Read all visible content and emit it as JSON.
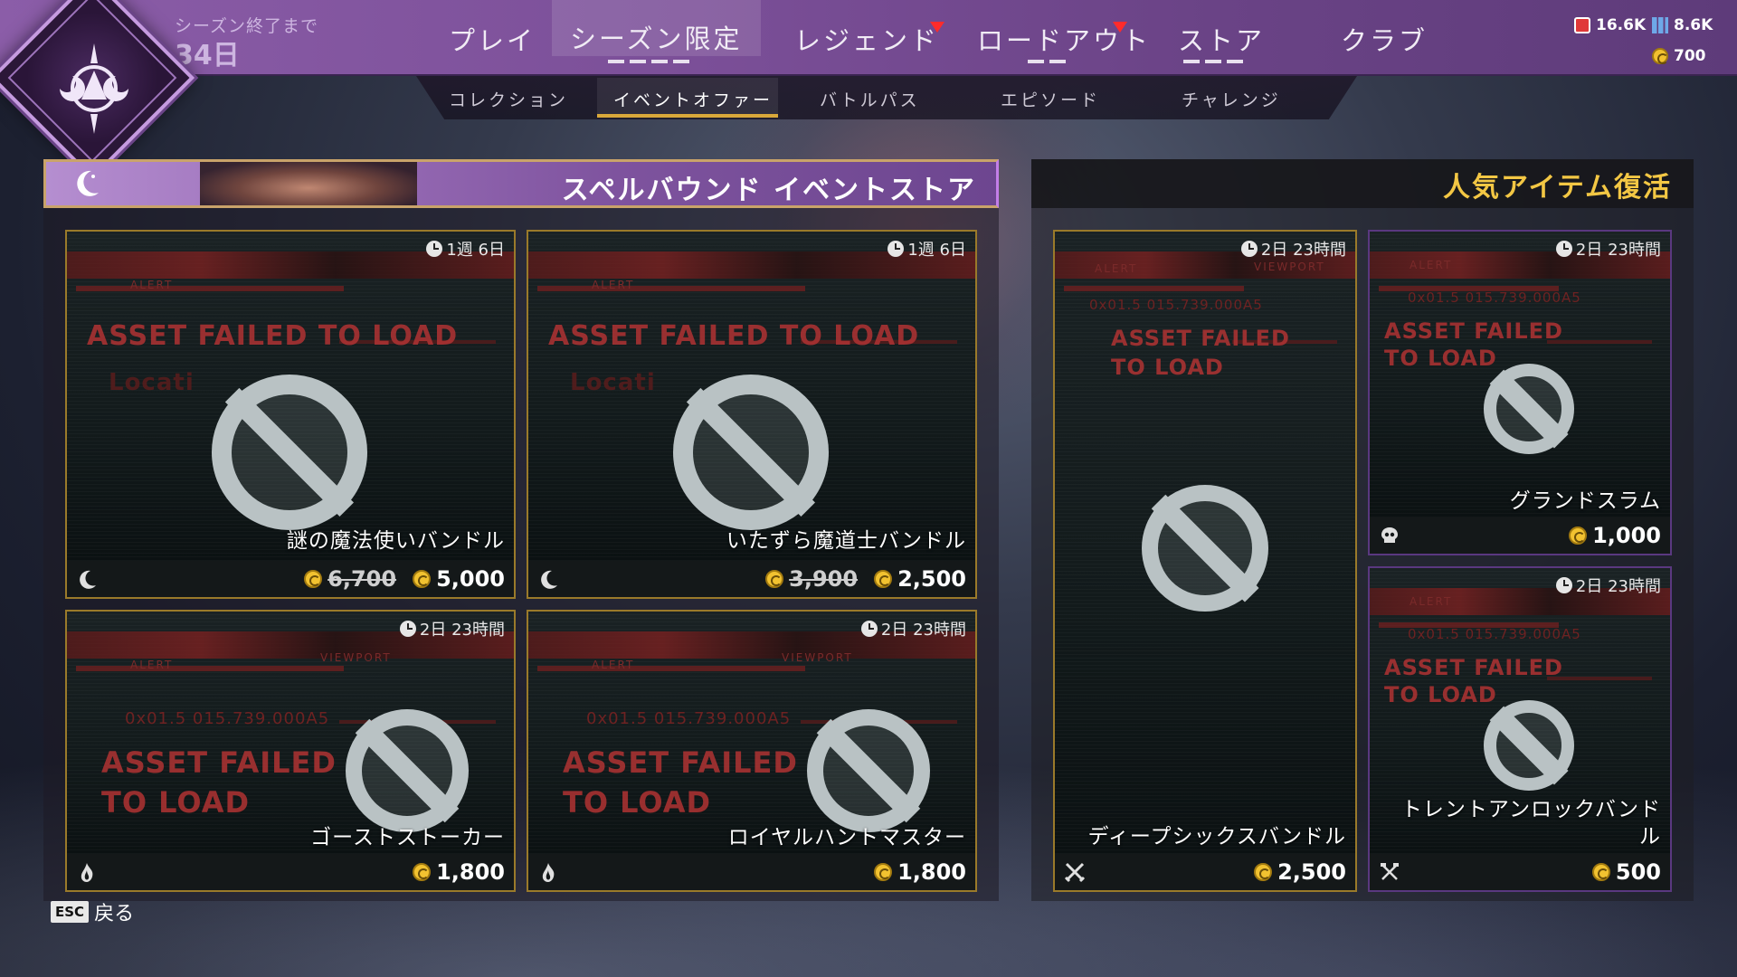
{
  "season": {
    "label": "シーズン終了まで",
    "remaining": "34日"
  },
  "nav": {
    "items": [
      {
        "label": "プレイ",
        "notify": false
      },
      {
        "label": "シーズン限定",
        "notify": false,
        "active": true
      },
      {
        "label": "レジェンド",
        "notify": true
      },
      {
        "label": "ロードアウト",
        "notify": true
      },
      {
        "label": "ストア",
        "notify": false
      },
      {
        "label": "クラブ",
        "notify": false
      }
    ],
    "subitems": [
      "コレクション",
      "イベントオファー",
      "バトルパス",
      "エピソード",
      "チャレンジ"
    ],
    "active_subitem": "イベントオファー"
  },
  "currencies": {
    "legend_tokens": "16.6K",
    "crafting_metals": "8.6K",
    "apex_coins": "700"
  },
  "event_store": {
    "title": "スペルバウンド イベントストア",
    "items": [
      {
        "name": "謎の魔法使いバンドル",
        "timer": "1週 6日",
        "old_price": "6,700",
        "price": "5,000",
        "icon": "crescent-moon-icon"
      },
      {
        "name": "いたずら魔道士バンドル",
        "timer": "1週 6日",
        "old_price": "3,900",
        "price": "2,500",
        "icon": "crescent-moon-icon"
      },
      {
        "name": "ゴーストストーカー",
        "timer": "2日 23時間",
        "price": "1,800",
        "icon": "flame-icon"
      },
      {
        "name": "ロイヤルハントマスター",
        "timer": "2日 23時間",
        "price": "1,800",
        "icon": "flame-icon"
      }
    ]
  },
  "popular": {
    "title": "人気アイテム復活",
    "items": [
      {
        "name": "ディープシックスバンドル",
        "timer": "2日 23時間",
        "price": "2,500",
        "icon": "crossed-blades-icon"
      },
      {
        "name": "グランドスラム",
        "timer": "2日 23時間",
        "price": "1,000",
        "icon": "skull-icon"
      },
      {
        "name": "トレントアンロックバンドル",
        "timer": "2日 23時間",
        "price": "500",
        "icon": "crossed-tools-icon"
      }
    ]
  },
  "placeholder_art": {
    "error_text": "ASSET FAILED TO LOAD",
    "error_line1": "ASSET FAILED",
    "error_line2": "TO LOAD",
    "alert": "ALERT",
    "viewport": "VIEWPORT",
    "location": "Locati",
    "code": "0x01.5   015.739.000A5"
  },
  "footer": {
    "esc_key": "ESC",
    "back_label": "戻る"
  },
  "colors": {
    "topbar": "#7b4f98",
    "accent_gold": "#f3c744",
    "card_border": "#9a7a2a"
  }
}
